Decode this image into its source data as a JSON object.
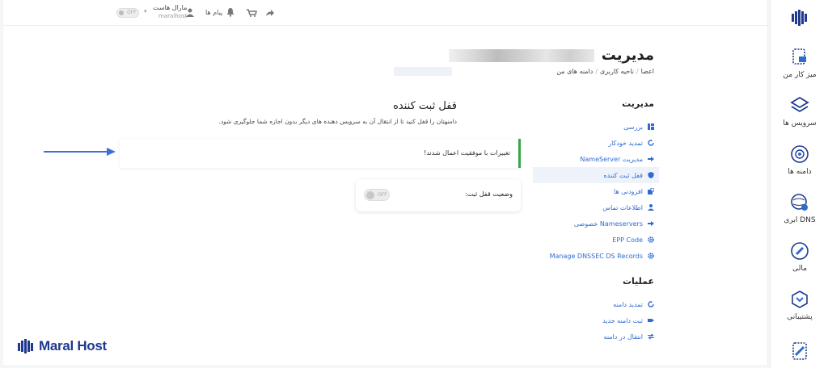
{
  "topbar": {
    "user_name": "مارال هاست",
    "user_sub": "maralhost",
    "messages": "پیام ها",
    "toggle_text": "OFF"
  },
  "page": {
    "title": "مدیریت",
    "breadcrumb": [
      "اعضا",
      "ناحیه کاربری",
      "دامنه های من"
    ]
  },
  "nav": {
    "heading": "مدیریت",
    "items": [
      {
        "label": "بررسی",
        "icon": "overview-icon"
      },
      {
        "label": "تمدید خودکار",
        "icon": "refresh-icon"
      },
      {
        "label": "مدیریت NameServer",
        "icon": "arrow-right-icon"
      },
      {
        "label": "قفل ثبت کننده",
        "icon": "shield-icon",
        "active": true
      },
      {
        "label": "افزودنی ها",
        "icon": "addons-icon"
      },
      {
        "label": "اطلاعات تماس",
        "icon": "user-icon"
      },
      {
        "label": "Nameservers خصوصی",
        "icon": "arrow-right-icon"
      },
      {
        "label": "EPP Code",
        "icon": "gear-icon"
      },
      {
        "label": "Manage DNSSEC DS Records",
        "icon": "gear-icon"
      }
    ],
    "ops_heading": "عملیات",
    "ops": [
      {
        "label": "تمدید دامنه",
        "icon": "refresh-icon"
      },
      {
        "label": "ثبت دامنه جدید",
        "icon": "tag-icon"
      },
      {
        "label": "انتقال در دامنه",
        "icon": "transfer-icon"
      }
    ]
  },
  "content": {
    "title": "قفل ثبت کننده",
    "description": "دامنهتان را قفل کنید تا از انتقال آن به سرویس دهنده های دیگر بدون اجازه شما جلوگیری شود.",
    "alert": "تغییرات با موفقیت اعمال شدند!",
    "lock_label": "وضعیت قفل ثبت:",
    "lock_state": "OFF"
  },
  "rail": {
    "items": [
      {
        "label": "میز کار من",
        "icon": "dashboard-icon"
      },
      {
        "label": "سرویس ها",
        "icon": "layers-icon"
      },
      {
        "label": "دامنه ها",
        "icon": "globe-icon"
      },
      {
        "label": "DNS ابری",
        "icon": "cloud-dns-icon"
      },
      {
        "label": "مالی",
        "icon": "finance-icon"
      },
      {
        "label": "پشتیبانی",
        "icon": "support-icon"
      }
    ]
  },
  "brand": {
    "name": "Maral Host"
  },
  "colors": {
    "link": "#2e6bd1",
    "success": "#3aa54a",
    "brand": "#1f3a8f"
  }
}
